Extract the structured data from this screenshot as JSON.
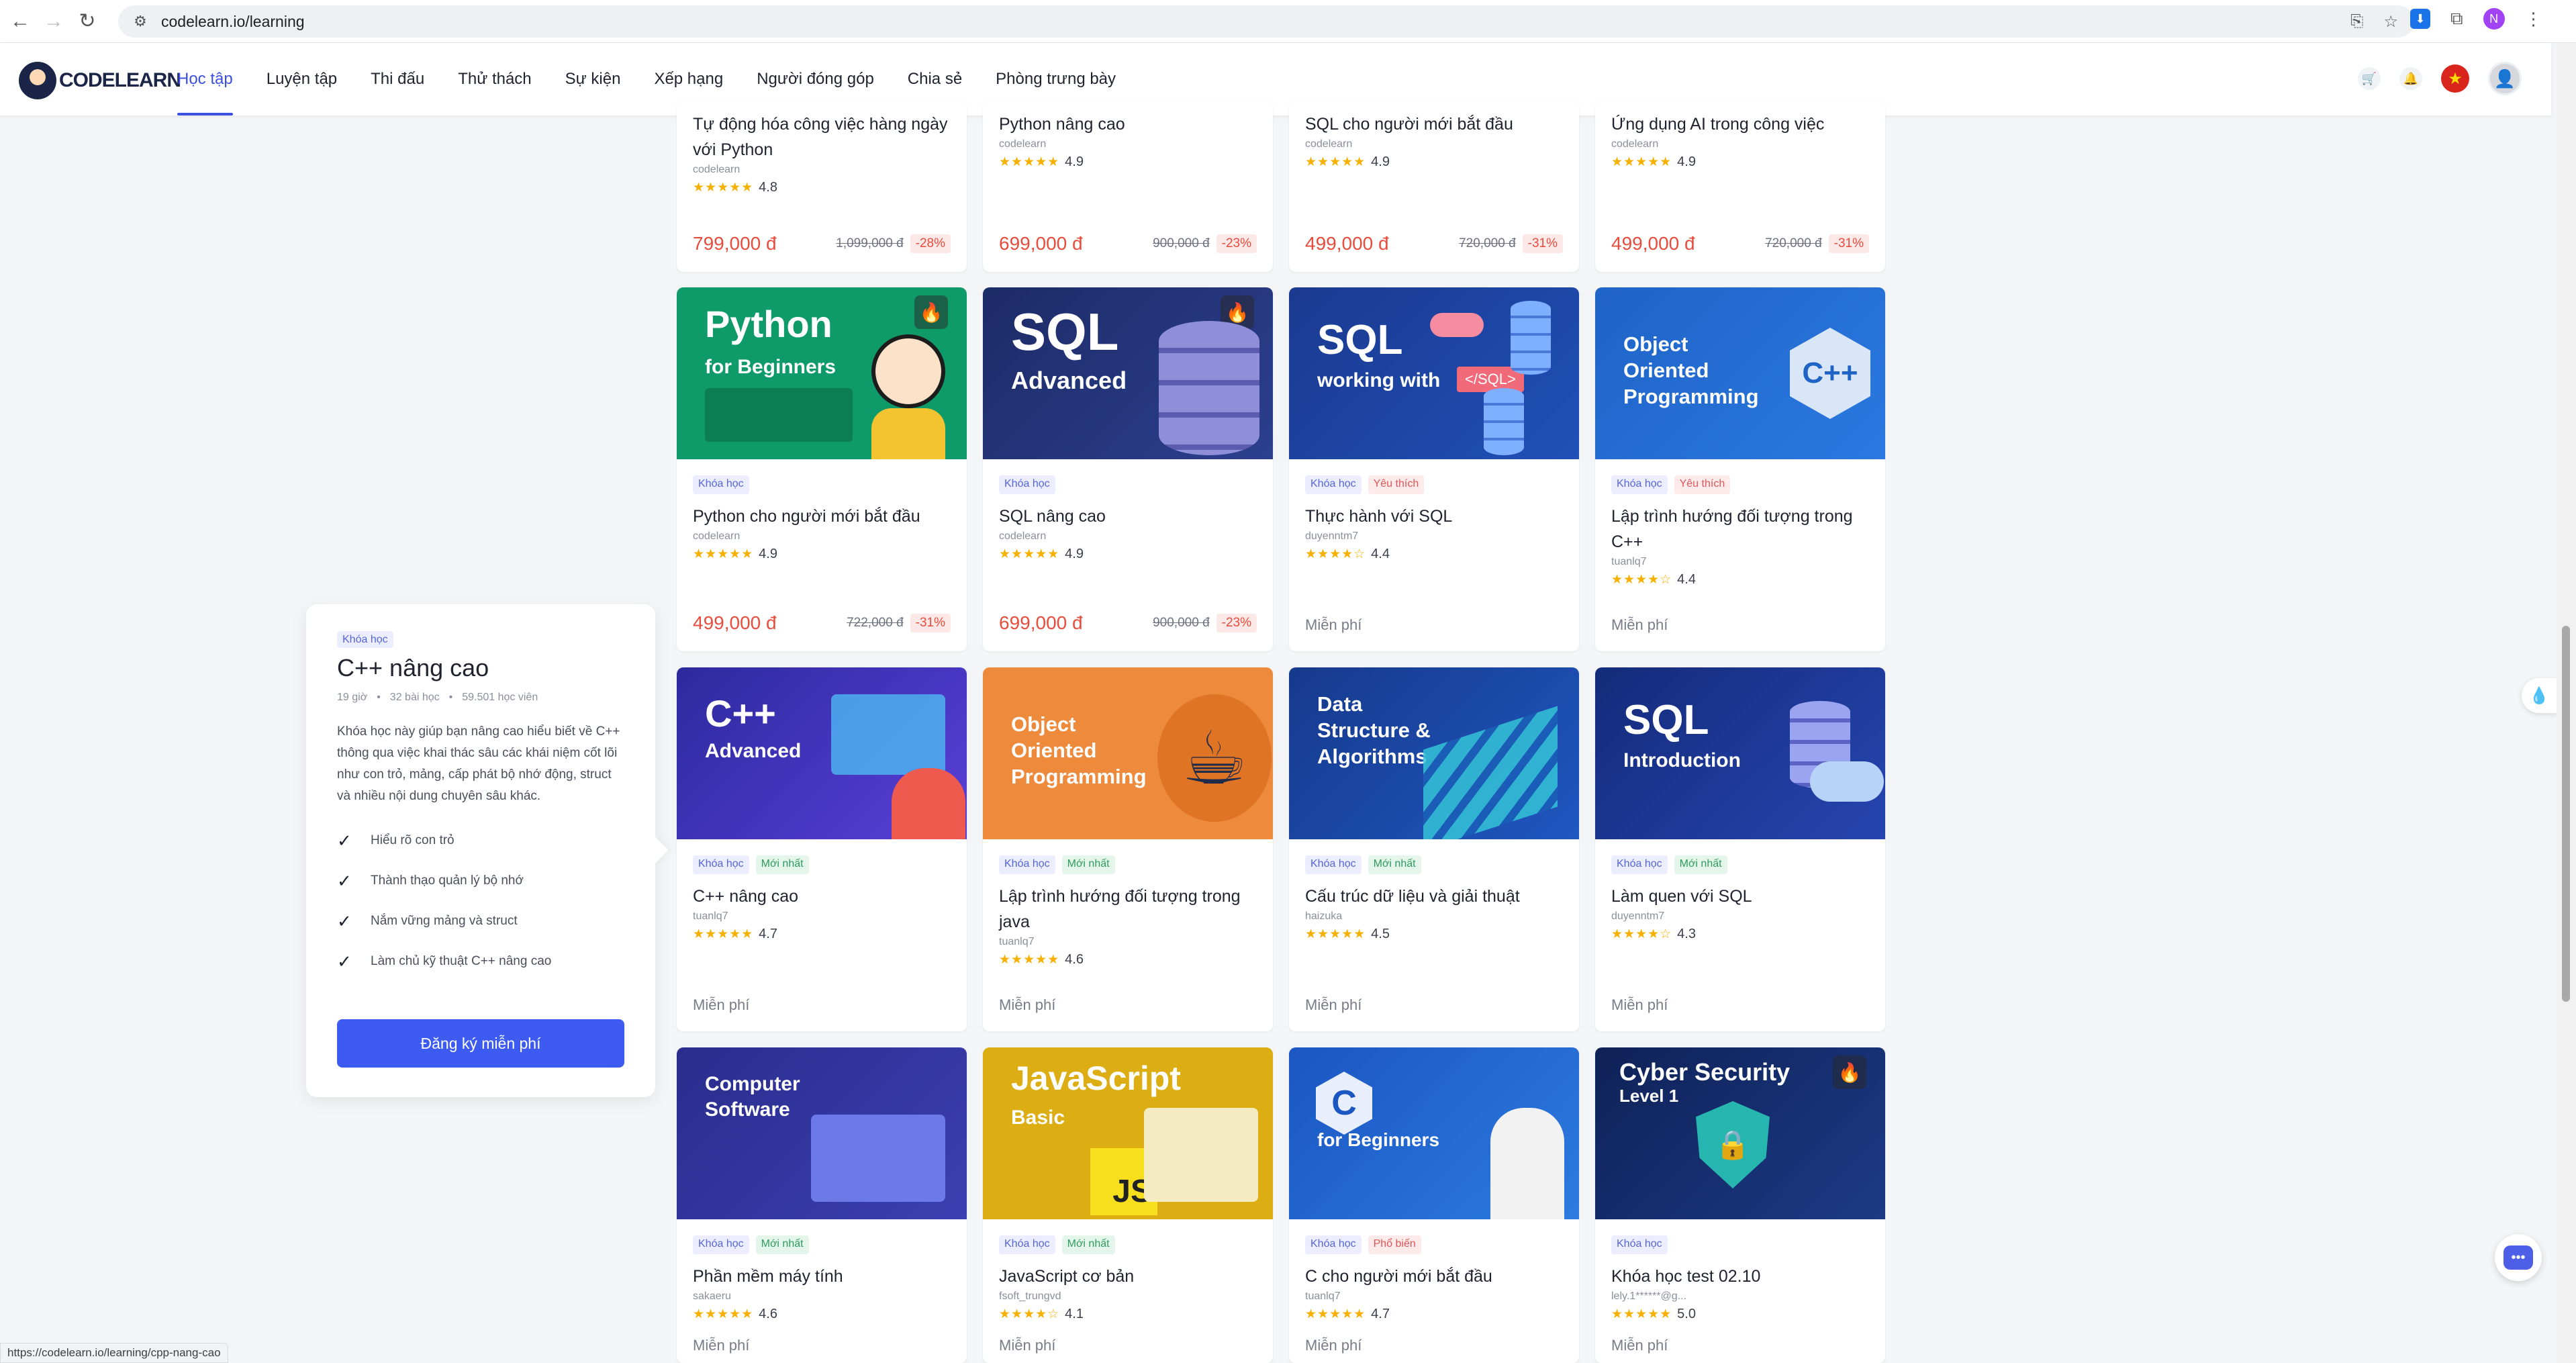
{
  "browser": {
    "url": "codelearn.io/learning",
    "status_url": "https://codelearn.io/learning/cpp-nang-cao",
    "profile_initial": "N"
  },
  "header": {
    "logo_text": "CODELEARN",
    "nav": [
      "Học tập",
      "Luyện tập",
      "Thi đấu",
      "Thử thách",
      "Sự kiện",
      "Xếp hạng",
      "Người đóng góp",
      "Chia sẻ",
      "Phòng trưng bày"
    ],
    "active_nav": "Học tập"
  },
  "colors": {
    "accent": "#3d5af1",
    "price": "#e74c3c",
    "star": "#f6b000"
  },
  "popover": {
    "tag": "Khóa học",
    "title": "C++ nâng cao",
    "hours": "19 giờ",
    "lessons": "32 bài học",
    "students": "59.501 học viên",
    "description": "Khóa học này giúp bạn nâng cao hiểu biết về C++ thông qua việc khai thác sâu các khái niệm cốt lõi như con trỏ, mảng, cấp phát bộ nhớ động, struct và nhiều nội dung chuyên sâu khác.",
    "points": [
      "Hiểu rõ con trỏ",
      "Thành thạo quản lý bộ nhớ",
      "Nắm vững mảng và struct",
      "Làm chủ kỹ thuật C++ nâng cao"
    ],
    "cta": "Đăng ký miễn phí"
  },
  "courses": {
    "row0": [
      {
        "title": "Tự động hóa công việc hàng ngày với Python",
        "author": "codelearn",
        "stars": "★★★★★",
        "rating": "4.8",
        "price": "799,000 đ",
        "old_price": "1,099,000 đ",
        "discount": "-28%"
      },
      {
        "title": "Python nâng cao",
        "author": "codelearn",
        "stars": "★★★★★",
        "rating": "4.9",
        "price": "699,000 đ",
        "old_price": "900,000 đ",
        "discount": "-23%"
      },
      {
        "title": "SQL cho người mới bắt đầu",
        "author": "codelearn",
        "stars": "★★★★★",
        "rating": "4.9",
        "price": "499,000 đ",
        "old_price": "720,000 đ",
        "discount": "-31%"
      },
      {
        "title": "Ứng dụng AI trong công việc",
        "author": "codelearn",
        "stars": "★★★★★",
        "rating": "4.9",
        "price": "499,000 đ",
        "old_price": "720,000 đ",
        "discount": "-31%"
      }
    ],
    "row1": [
      {
        "thumb_title": "Python",
        "thumb_sub": "for Beginners",
        "tag1": "Khóa học",
        "title": "Python cho người mới bắt đầu",
        "author": "codelearn",
        "stars": "★★★★★",
        "rating": "4.9",
        "price": "499,000 đ",
        "old_price": "722,000 đ",
        "discount": "-31%"
      },
      {
        "thumb_title": "SQL",
        "thumb_sub": "Advanced",
        "tag1": "Khóa học",
        "title": "SQL nâng cao",
        "author": "codelearn",
        "stars": "★★★★★",
        "rating": "4.9",
        "price": "699,000 đ",
        "old_price": "900,000 đ",
        "discount": "-23%"
      },
      {
        "thumb_title": "SQL",
        "thumb_sub": "working with",
        "thumb_badge": "</SQL>",
        "tag1": "Khóa học",
        "tag2": "Yêu thích",
        "title": "Thực hành với SQL",
        "author": "duyenntm7",
        "stars": "★★★★☆",
        "rating": "4.4",
        "free": "Miễn phí"
      },
      {
        "thumb_title": "Object Oriented Programming",
        "thumb_glyph": "C++",
        "tag1": "Khóa học",
        "tag2": "Yêu thích",
        "title": "Lập trình hướng đối tượng trong C++",
        "author": "tuanlq7",
        "stars": "★★★★☆",
        "rating": "4.4",
        "free": "Miễn phí"
      }
    ],
    "row2": [
      {
        "thumb_title": "C++",
        "thumb_sub": "Advanced",
        "tag1": "Khóa học",
        "tag2": "Mới nhất",
        "title": "C++ nâng cao",
        "author": "tuanlq7",
        "stars": "★★★★★",
        "rating": "4.7",
        "free": "Miễn phí"
      },
      {
        "thumb_title": "Object Oriented Programming",
        "tag1": "Khóa học",
        "tag2": "Mới nhất",
        "title": "Lập trình hướng đối tượng trong java",
        "author": "tuanlq7",
        "stars": "★★★★★",
        "rating": "4.6",
        "free": "Miễn phí"
      },
      {
        "thumb_title": "Data Structure & Algorithms",
        "tag1": "Khóa học",
        "tag2": "Mới nhất",
        "title": "Cấu trúc dữ liệu và giải thuật",
        "author": "haizuka",
        "stars": "★★★★★",
        "rating": "4.5",
        "free": "Miễn phí"
      },
      {
        "thumb_title": "SQL",
        "thumb_sub": "Introduction",
        "tag1": "Khóa học",
        "tag2": "Mới nhất",
        "title": "Làm quen với SQL",
        "author": "duyenntm7",
        "stars": "★★★★☆",
        "rating": "4.3",
        "free": "Miễn phí"
      }
    ],
    "row3": [
      {
        "thumb_title": "Computer Software",
        "tag1": "Khóa học",
        "tag2": "Mới nhất",
        "title": "Phần mềm máy tính",
        "author": "sakaeru",
        "stars": "★★★★★",
        "rating": "4.6",
        "free": "Miễn phí"
      },
      {
        "thumb_title": "JavaScript",
        "thumb_sub": "Basic",
        "thumb_badge": "JS",
        "tag1": "Khóa học",
        "tag2": "Mới nhất",
        "title": "JavaScript cơ bản",
        "author": "fsoft_trungvd",
        "stars": "★★★★☆",
        "rating": "4.1",
        "free": "Miễn phí"
      },
      {
        "thumb_title": "C",
        "thumb_sub": "for Beginners",
        "tag1": "Khóa học",
        "tag2": "Phổ biến",
        "title": "C cho người mới bắt đầu",
        "author": "tuanlq7",
        "stars": "★★★★★",
        "rating": "4.7",
        "free": "Miễn phí"
      },
      {
        "thumb_title": "Cyber Security",
        "thumb_sub": "Level 1",
        "tag1": "Khóa học",
        "title": "Khóa học test 02.10",
        "author": "lely.1******@g...",
        "stars": "★★★★★",
        "rating": "5.0",
        "free": "Miễn phí"
      }
    ]
  }
}
